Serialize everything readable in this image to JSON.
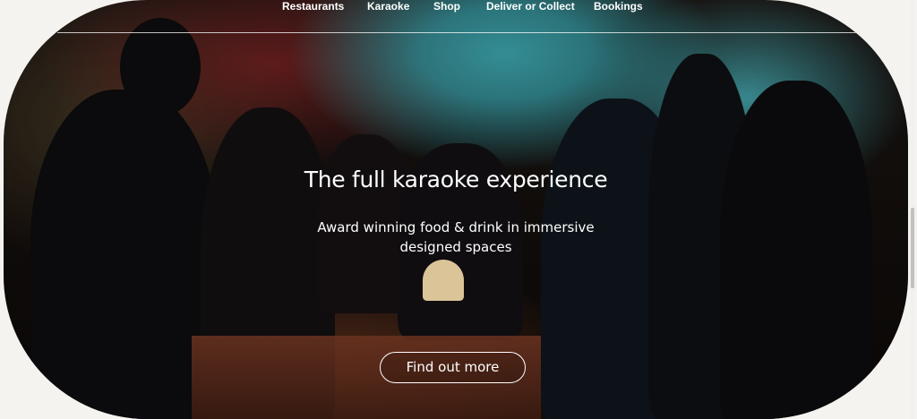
{
  "nav": {
    "items": [
      {
        "label": "Restaurants"
      },
      {
        "label": "Karaoke"
      },
      {
        "label": "Shop"
      },
      {
        "label": "Deliver or Collect"
      },
      {
        "label": "Bookings"
      }
    ]
  },
  "hero": {
    "title": "The full karaoke experience",
    "subtitle_line1": "Award winning food & drink in immersive",
    "subtitle_line2": "designed spaces",
    "cta_label": "Find out more",
    "image_icon": "party-photo-image"
  },
  "colors": {
    "page_background": "#f4f3ef",
    "text": "#ffffff",
    "scrollbar_thumb": "#c1c1c1"
  }
}
